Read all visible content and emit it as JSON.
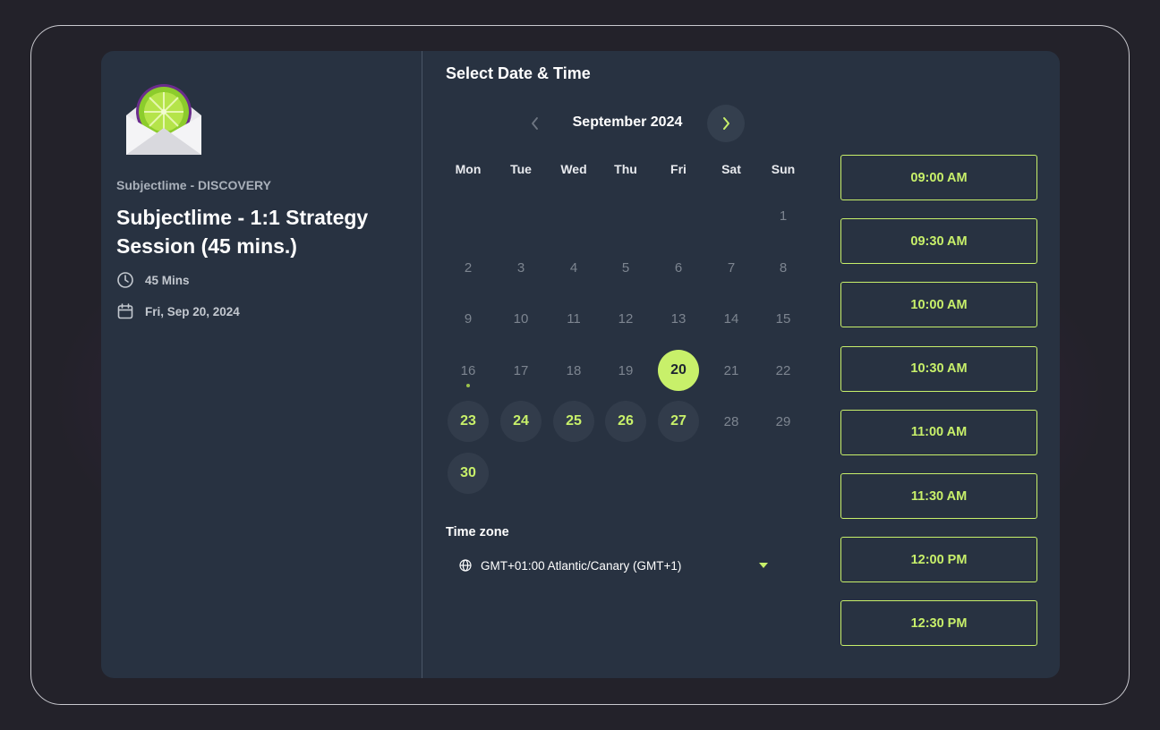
{
  "event": {
    "org": "Subjectlime - DISCOVERY",
    "title": "Subjectlime - 1:1 Strategy Session (45 mins.)",
    "duration": "45 Mins",
    "date": "Fri, Sep 20, 2024"
  },
  "calendar": {
    "heading": "Select Date & Time",
    "month": "September 2024",
    "weekdays": [
      "Mon",
      "Tue",
      "Wed",
      "Thu",
      "Fri",
      "Sat",
      "Sun"
    ],
    "weeks": [
      [
        "",
        "",
        "",
        "",
        "",
        "",
        "1"
      ],
      [
        "2",
        "3",
        "4",
        "5",
        "6",
        "7",
        "8"
      ],
      [
        "9",
        "10",
        "11",
        "12",
        "13",
        "14",
        "15"
      ],
      [
        "16",
        "17",
        "18",
        "19",
        "20",
        "21",
        "22"
      ],
      [
        "23",
        "24",
        "25",
        "26",
        "27",
        "28",
        "29"
      ],
      [
        "30",
        "",
        "",
        "",
        "",
        "",
        ""
      ]
    ],
    "selected_day": "20",
    "today_day": "16",
    "available_days": [
      "23",
      "24",
      "25",
      "26",
      "27",
      "30"
    ]
  },
  "timezone": {
    "label": "Time zone",
    "value": "GMT+01:00 Atlantic/Canary (GMT+1)"
  },
  "slots": [
    "09:00 AM",
    "09:30 AM",
    "10:00 AM",
    "10:30 AM",
    "11:00 AM",
    "11:30 AM",
    "12:00 PM",
    "12:30 PM"
  ],
  "colors": {
    "accent": "#c8f06a",
    "card": "#283241",
    "page": "#23222a"
  },
  "icons": {
    "logo": "lime-envelope-logo",
    "duration": "clock-icon",
    "date": "calendar-icon",
    "prev": "chevron-left-icon",
    "next": "chevron-right-icon",
    "timezone": "globe-icon",
    "dropdown": "caret-down-icon"
  }
}
